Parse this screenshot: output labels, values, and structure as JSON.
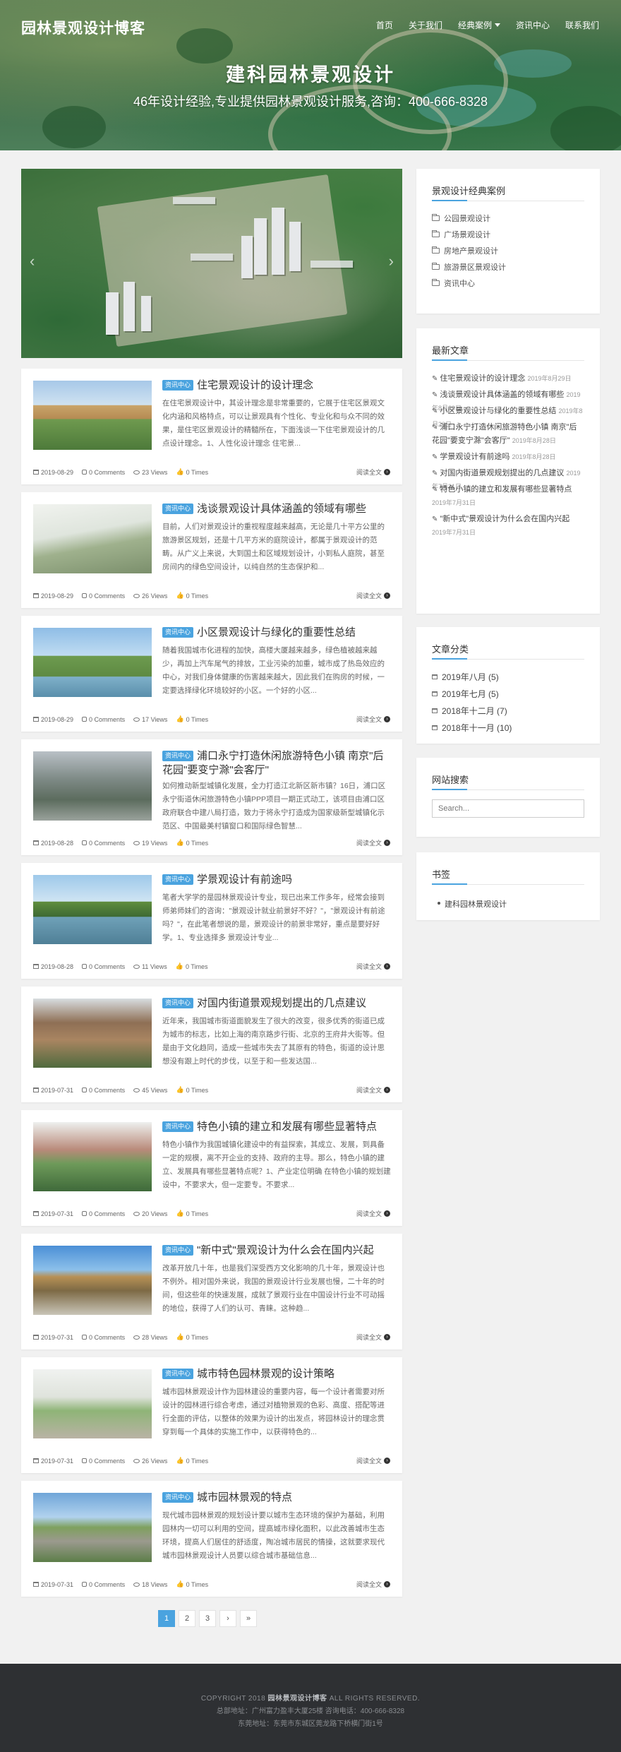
{
  "site": {
    "logo": "园林景观设计博客",
    "nav": [
      {
        "label": "首页",
        "has_caret": false
      },
      {
        "label": "关于我们",
        "has_caret": false
      },
      {
        "label": "经典案例",
        "has_caret": true
      },
      {
        "label": "资讯中心",
        "has_caret": false
      },
      {
        "label": "联系我们",
        "has_caret": false
      }
    ],
    "banner_title": "建科园林景观设计",
    "banner_subtitle": "46年设计经验,专业提供园林景观设计服务,咨询：400-666-8328"
  },
  "posts": [
    {
      "tag": "资讯中心",
      "title": "住宅景观设计的设计理念",
      "excerpt": "在住宅景观设计中，其设计理念是非常重要的，它展于住宅区景观文化内涵和风格特点，可以让景观具有个性化、专业化和与众不同的效果，是住宅区景观设计的精髓所在，下面浅谈一下住宅景观设计的几点设计理念。1、人性化设计理念 住宅景...",
      "date": "2019-08-29",
      "comments": "0 Comments",
      "views": "23 Views",
      "likes": "0 Times",
      "read_more": "阅读全文"
    },
    {
      "tag": "资讯中心",
      "title": "浅谈景观设计具体涵盖的领域有哪些",
      "excerpt": "目前，人们对景观设计的重视程度越来越高，无论是几十平方公里的旅游景区规划，还是十几平方米的庭院设计，都属于景观设计的范畴。从广义上来说，大到国土和区域规划设计，小到私人庭院，甚至房间内的绿色空间设计，以纯自然的生态保护和...",
      "date": "2019-08-29",
      "comments": "0 Comments",
      "views": "26 Views",
      "likes": "0 Times",
      "read_more": "阅读全文"
    },
    {
      "tag": "资讯中心",
      "title": "小区景观设计与绿化的重要性总结",
      "excerpt": "随着我国城市化进程的加快，高楼大厦越来越多，绿色植被越来越少，再加上汽车尾气的排放，工业污染的加重，城市成了热岛效应的中心，对我们身体健康的伤害越来越大，因此我们在购房的时候，一定要选择绿化环境较好的小区。一个好的小区...",
      "date": "2019-08-29",
      "comments": "0 Comments",
      "views": "17 Views",
      "likes": "0 Times",
      "read_more": "阅读全文"
    },
    {
      "tag": "资讯中心",
      "title": "浦口永宁打造休闲旅游特色小镇 南京\"后花园\"要变宁滁\"会客厅\"",
      "excerpt": "如何推动新型城镇化发展，全力打造江北新区新市镇？16日，浦口区永宁街道休闲旅游特色小镇PPP项目一期正式动工，该项目由浦口区政府联合中建八局打造，致力于将永宁打造成为国家级新型城镇化示范区、中国最美村镇窗口和国际绿色智慧...",
      "date": "2019-08-28",
      "comments": "0 Comments",
      "views": "19 Views",
      "likes": "0 Times",
      "read_more": "阅读全文"
    },
    {
      "tag": "资讯中心",
      "title": "学景观设计有前途吗",
      "excerpt": "笔者大学学的是园林景观设计专业，现已出来工作多年，经常会接到师弟师妹们的咨询：\"景观设计就业前景好不好？\"，\"景观设计有前途吗？\"，在此笔者想说的是，景观设计的前景非常好，重点是要好好学。1、专业选择多 景观设计专业...",
      "date": "2019-08-28",
      "comments": "0 Comments",
      "views": "11 Views",
      "likes": "0 Times",
      "read_more": "阅读全文"
    },
    {
      "tag": "资讯中心",
      "title": "对国内街道景观规划提出的几点建议",
      "excerpt": "近年来，我国城市街道面貌发生了很大的改变，很多优秀的街道已成为城市的标志，比如上海的南京路步行街、北京的王府井大街等。但是由于文化趋同，造成一些城市失去了其原有的特色，街道的设计思想没有跟上时代的步伐，以至于和一些发达国...",
      "date": "2019-07-31",
      "comments": "0 Comments",
      "views": "45 Views",
      "likes": "0 Times",
      "read_more": "阅读全文"
    },
    {
      "tag": "资讯中心",
      "title": "特色小镇的建立和发展有哪些显著特点",
      "excerpt": "特色小镇作为我国城镇化建设中的有益探索，其成立、发展，到具备一定的规模，离不开企业的支持、政府的主导。那么，特色小镇的建立、发展具有哪些显著特点呢？1、产业定位明确 在特色小镇的规划建设中，不要求大，但一定要专。不要求...",
      "date": "2019-07-31",
      "comments": "0 Comments",
      "views": "20 Views",
      "likes": "0 Times",
      "read_more": "阅读全文"
    },
    {
      "tag": "资讯中心",
      "title": "\"新中式\"景观设计为什么会在国内兴起",
      "excerpt": "改革开放几十年，也是我们深受西方文化影响的几十年，景观设计也不例外。相对国外来说，我国的景观设计行业发展也慢，二十年的时间，但这些年的快速发展，成就了景观行业在中国设计行业不可动摇的地位，获得了人们的认可、青睐。这种趋...",
      "date": "2019-07-31",
      "comments": "0 Comments",
      "views": "28 Views",
      "likes": "0 Times",
      "read_more": "阅读全文"
    },
    {
      "tag": "资讯中心",
      "title": "城市特色园林景观的设计策略",
      "excerpt": "城市园林景观设计作为园林建设的重要内容，每一个设计者需要对所设计的园林进行综合考虑，通过对植物景观的色彩、高度、搭配等进行全面的评估，以整体的效果为设计的出发点，将园林设计的理念贯穿到每一个具体的实施工作中，以获得特色的...",
      "date": "2019-07-31",
      "comments": "0 Comments",
      "views": "26 Views",
      "likes": "0 Times",
      "read_more": "阅读全文"
    },
    {
      "tag": "资讯中心",
      "title": "城市园林景观的特点",
      "excerpt": "现代城市园林景观的规划设计要以城市生态环境的保护为基础，利用园林内一切可以利用的空间，提高城市绿化面积，以此改善城市生态环境，提高人们居住的舒适度，陶冶城市居民的情操，这就要求现代城市园林景观设计人员要以综合城市基础信息...",
      "date": "2019-07-31",
      "comments": "0 Comments",
      "views": "18 Views",
      "likes": "0 Times",
      "read_more": "阅读全文"
    }
  ],
  "sidebar": {
    "cases": {
      "title": "景观设计经典案例",
      "items": [
        "公园景观设计",
        "广场景观设计",
        "房地产景观设计",
        "旅游景区景观设计",
        "资讯中心"
      ]
    },
    "recent": {
      "title": "最新文章",
      "items": [
        {
          "title": "住宅景观设计的设计理念",
          "date": "2019年8月29日"
        },
        {
          "title": "浅谈景观设计具体涵盖的领域有哪些",
          "date": "2019年8月29日"
        },
        {
          "title": "小区景观设计与绿化的重要性总结",
          "date": "2019年8月29日"
        },
        {
          "title": "浦口永宁打造休闲旅游特色小镇 南京\"后花园\"要变宁滁\"会客厅\"",
          "date": "2019年8月28日"
        },
        {
          "title": "学景观设计有前途吗",
          "date": "2019年8月28日"
        },
        {
          "title": "对国内街道景观规划提出的几点建议",
          "date": "2019年7月31日"
        },
        {
          "title": "特色小镇的建立和发展有哪些显著特点",
          "date": "2019年7月31日"
        },
        {
          "title": "\"新中式\"景观设计为什么会在国内兴起",
          "date": "2019年7月31日"
        }
      ]
    },
    "archives": {
      "title": "文章分类",
      "items": [
        "2019年八月 (5)",
        "2019年七月 (5)",
        "2018年十二月 (7)",
        "2018年十一月 (10)"
      ]
    },
    "search": {
      "title": "网站搜索",
      "placeholder": "Search..."
    },
    "bookmarks": {
      "title": "书签",
      "items": [
        "建科园林景观设计"
      ]
    }
  },
  "pagination": {
    "pages": [
      "1",
      "2",
      "3"
    ],
    "next": "›",
    "last": "»",
    "active": "1"
  },
  "footer": {
    "copyright_prefix": "COPYRIGHT 2018 ",
    "copyright_name": "园林景观设计博客",
    "copyright_suffix": " ALL RIGHTS RESERVED.",
    "address1": "总部地址：广州富力盈丰大厦25楼 咨询电话：400-666-8328",
    "address2": "东莞地址：东莞市东城区莞龙路下桥横门街1号"
  },
  "colors": {
    "accent": "#4aa3df",
    "footer_bg": "#2e3033",
    "page_bg": "#f1f1f1"
  }
}
